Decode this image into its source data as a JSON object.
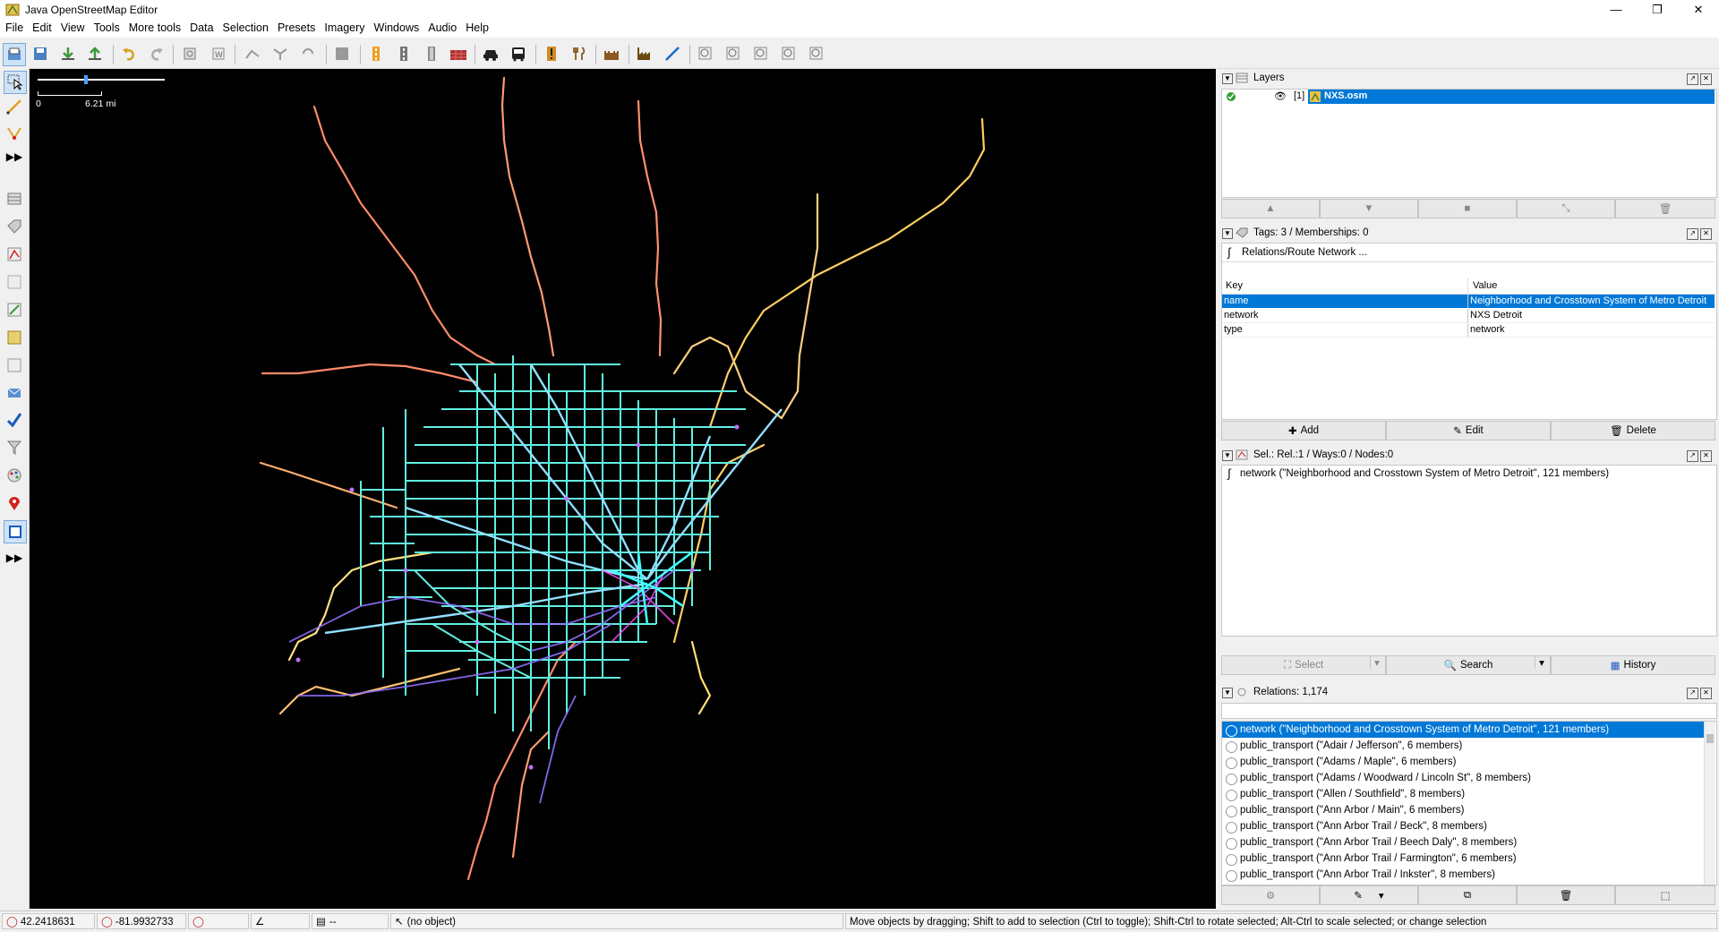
{
  "window": {
    "title": "Java OpenStreetMap Editor"
  },
  "menu": [
    {
      "label": "File"
    },
    {
      "label": "Edit"
    },
    {
      "label": "View"
    },
    {
      "label": "Tools"
    },
    {
      "label": "More tools"
    },
    {
      "label": "Data"
    },
    {
      "label": "Selection"
    },
    {
      "label": "Presets"
    },
    {
      "label": "Imagery"
    },
    {
      "label": "Windows"
    },
    {
      "label": "Audio"
    },
    {
      "label": "Help"
    }
  ],
  "map": {
    "scale_zero": "0",
    "scale_label": "6.21 mi"
  },
  "layers": {
    "title": "Layers",
    "items": [
      {
        "index": "[1]",
        "name": "NXS.osm"
      }
    ]
  },
  "tags_panel": {
    "title": "Tags: 3 / Memberships: 0",
    "relation_header": "Relations/Route Network ...",
    "col_key": "Key",
    "col_value": "Value",
    "rows": [
      {
        "key": "name",
        "value": "Neighborhood and Crosstown System of Metro Detroit"
      },
      {
        "key": "network",
        "value": "NXS Detroit"
      },
      {
        "key": "type",
        "value": "network"
      }
    ],
    "add": "Add",
    "edit": "Edit",
    "delete": "Delete"
  },
  "selection_panel": {
    "title": "Sel.: Rel.:1 / Ways:0 / Nodes:0",
    "item": "network (\"Neighborhood and Crosstown System of Metro Detroit\", 121 members)",
    "select": "Select",
    "search": "Search",
    "history": "History"
  },
  "relations_panel": {
    "title": "Relations: 1,174",
    "items": [
      "network (\"Neighborhood and Crosstown System of Metro Detroit\", 121 members)",
      "public_transport (\"Adair / Jefferson\", 6 members)",
      "public_transport (\"Adams / Maple\", 6 members)",
      "public_transport (\"Adams / Woodward / Lincoln St\", 8 members)",
      "public_transport (\"Allen / Southfield\", 8 members)",
      "public_transport (\"Ann Arbor / Main\", 6 members)",
      "public_transport (\"Ann Arbor Trail / Beck\", 8 members)",
      "public_transport (\"Ann Arbor Trail / Beech Daly\", 8 members)",
      "public_transport (\"Ann Arbor Trail / Farmington\", 6 members)",
      "public_transport (\"Ann Arbor Trail / Inkster\", 8 members)"
    ]
  },
  "status": {
    "lat": "42.2418631",
    "lon": "-81.9932733",
    "heading": "",
    "angle": "",
    "dist": "--",
    "object": "(no object)",
    "help": "Move objects by dragging; Shift to add to selection (Ctrl to toggle); Shift-Ctrl to rotate selected; Alt-Ctrl to scale selected; or change selection"
  }
}
